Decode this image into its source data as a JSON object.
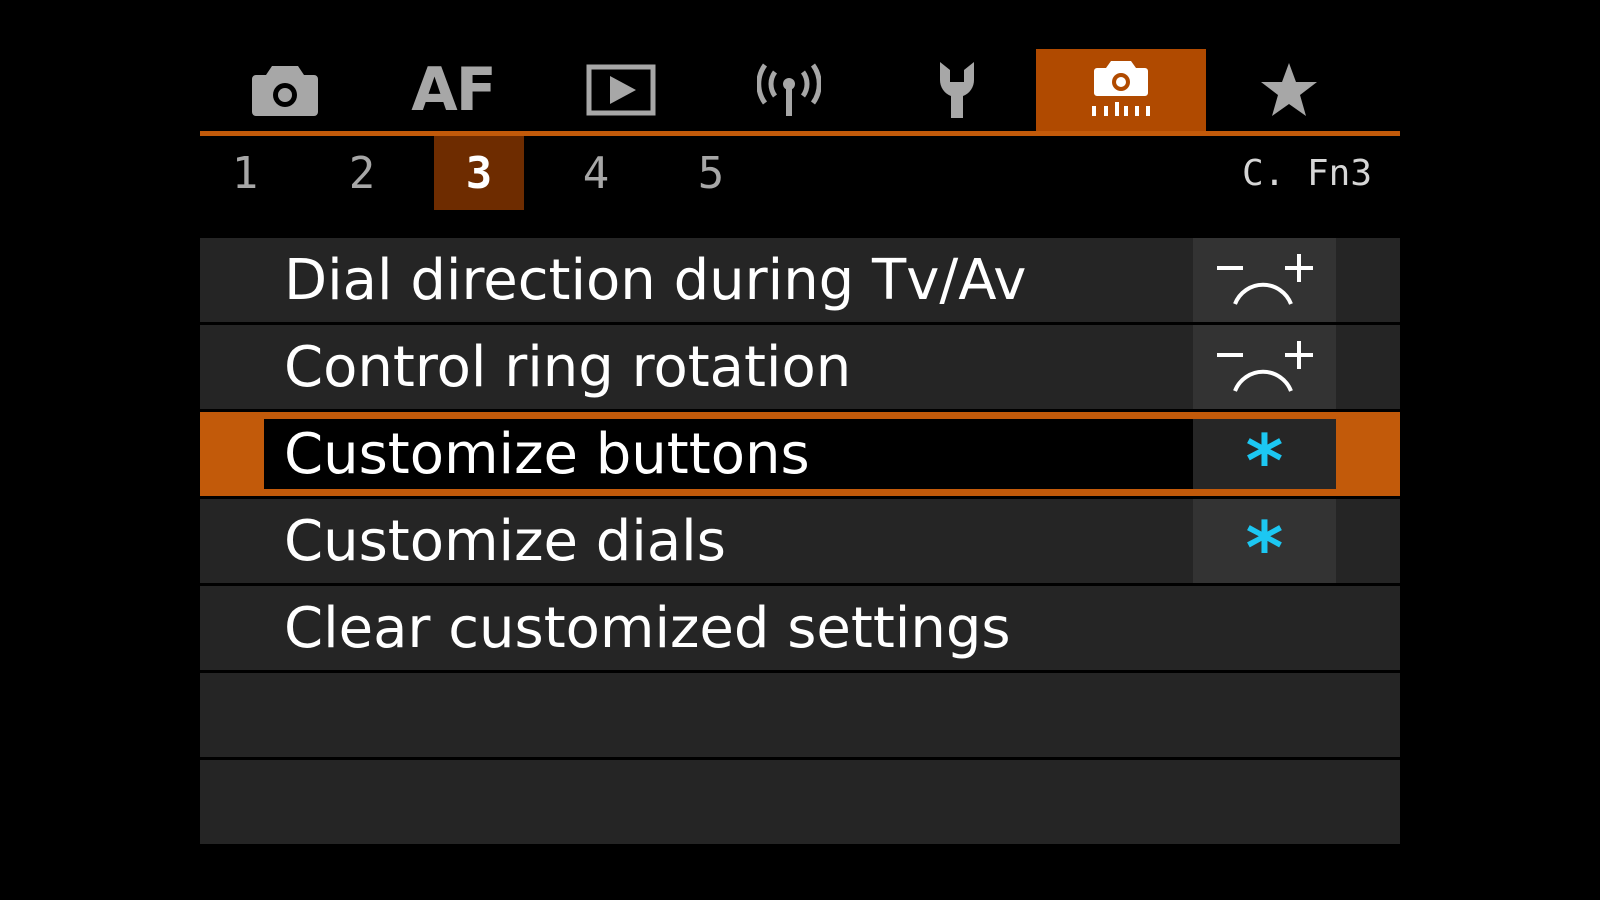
{
  "tabs": [
    {
      "id": "shooting",
      "icon": "camera-icon",
      "label": ""
    },
    {
      "id": "af",
      "icon": "",
      "label": "AF"
    },
    {
      "id": "playback",
      "icon": "playback-icon",
      "label": ""
    },
    {
      "id": "wireless",
      "icon": "wireless-icon",
      "label": ""
    },
    {
      "id": "setup",
      "icon": "wrench-icon",
      "label": ""
    },
    {
      "id": "custom-functions",
      "icon": "custom-functions-icon",
      "label": "",
      "active": true
    },
    {
      "id": "my-menu",
      "icon": "star-icon",
      "label": ""
    }
  ],
  "subtabs": [
    "1",
    "2",
    "3",
    "4",
    "5"
  ],
  "active_subtab": "3",
  "page_code": "C. Fn3",
  "menu": {
    "items": [
      {
        "label": "Dial direction during Tv/Av",
        "value_icon": "dial-direction-icon"
      },
      {
        "label": "Control ring rotation",
        "value_icon": "dial-direction-icon"
      },
      {
        "label": "Customize buttons",
        "value_icon": "asterisk-icon",
        "value_text": "*",
        "selected": true
      },
      {
        "label": "Customize dials",
        "value_icon": "asterisk-icon",
        "value_text": "*"
      },
      {
        "label": "Clear customized settings"
      },
      {
        "label": ""
      },
      {
        "label": ""
      }
    ]
  },
  "colors": {
    "accent": "#c25a0a",
    "active_tab": "#b04a00",
    "active_subtab": "#6e2c00",
    "row_bg": "#252525",
    "value_cell_bg": "#333333",
    "asterisk": "#1cc7f2",
    "inactive_icon": "#a7a7a7"
  }
}
